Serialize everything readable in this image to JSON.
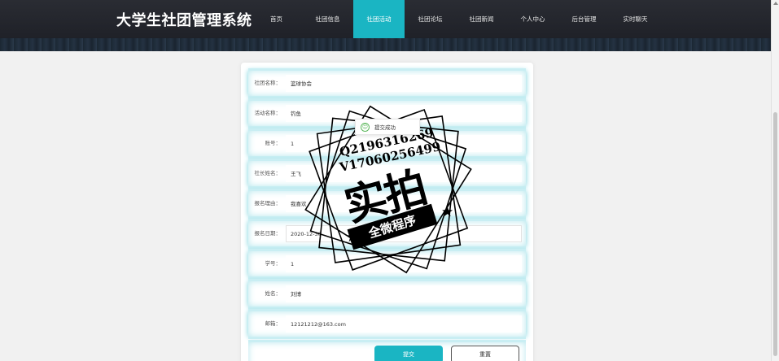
{
  "header": {
    "title": "大学生社团管理系统",
    "bg_color": "#23252c",
    "accent_color": "#1ab5c3",
    "nav": [
      {
        "label": "首页",
        "active": false
      },
      {
        "label": "社团信息",
        "active": false
      },
      {
        "label": "社团活动",
        "active": true
      },
      {
        "label": "社团论坛",
        "active": false
      },
      {
        "label": "社团新闻",
        "active": false
      },
      {
        "label": "个人中心",
        "active": false
      },
      {
        "label": "后台管理",
        "active": false
      },
      {
        "label": "实时聊天",
        "active": false
      }
    ]
  },
  "form": {
    "fields": [
      {
        "label": "社团名称：",
        "value": "篮球协会"
      },
      {
        "label": "活动名称：",
        "value": "钓鱼"
      },
      {
        "label": "账号：",
        "value": "1"
      },
      {
        "label": "社长姓名：",
        "value": "王飞"
      },
      {
        "label": "报名理由：",
        "value": "我喜欢"
      },
      {
        "label": "报名日期：",
        "value": "2020-12-30"
      },
      {
        "label": "学号：",
        "value": "1"
      },
      {
        "label": "姓名：",
        "value": "刘博"
      },
      {
        "label": "邮箱：",
        "value": "12121212@163.com"
      }
    ],
    "submit_label": "提交",
    "reset_label": "重置"
  },
  "toast": {
    "icon": "smile-icon",
    "text": "提交成功"
  },
  "watermark": {
    "line1": "Q2196316269",
    "line2": "V17060256499",
    "main": "实拍",
    "banner": "全微程序"
  }
}
